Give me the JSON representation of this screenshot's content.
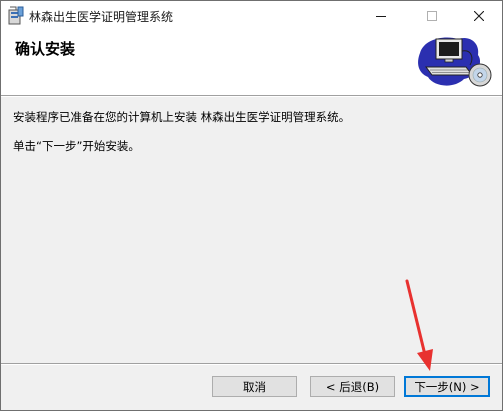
{
  "window": {
    "title": "林森出生医学证明管理系统",
    "icon": "installer-package-icon"
  },
  "controls": {
    "minimize_icon": "minimize-icon",
    "maximize_icon": "maximize-icon",
    "close_icon": "close-icon"
  },
  "header": {
    "title": "确认安装",
    "art_icon": "computer-disc-icon"
  },
  "content": {
    "line1": "安装程序已准备在您的计算机上安装 林森出生医学证明管理系统。",
    "line2": "单击“下一步”开始安装。"
  },
  "buttons": {
    "cancel": "取消",
    "back": "< 后退(B)",
    "next": "下一步(N) >"
  },
  "colors": {
    "annotation_arrow": "#e8312f",
    "focus_border": "#0078d7"
  }
}
